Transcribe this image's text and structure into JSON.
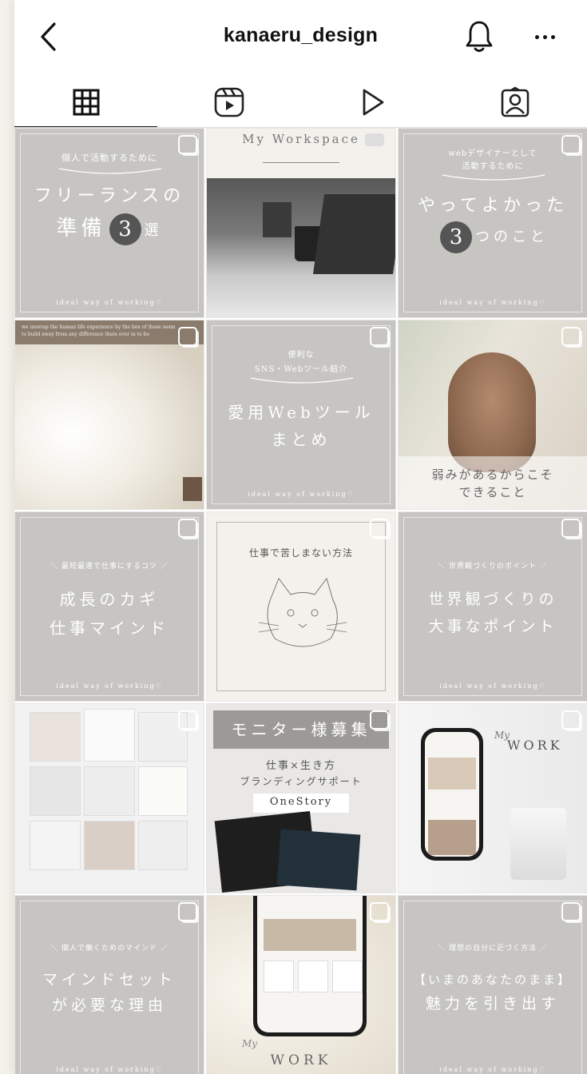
{
  "header": {
    "username": "kanaeru_design"
  },
  "tabs": [
    {
      "name": "grid"
    },
    {
      "name": "reels"
    },
    {
      "name": "videos"
    },
    {
      "name": "tagged"
    }
  ],
  "posts": {
    "p1": {
      "small": "個人で活動するために",
      "line1": "フリーランスの",
      "line2a": "準備",
      "num": "3",
      "line2b": "選",
      "foot": "ideal way of working♡"
    },
    "p2": {
      "title": "My Workspace"
    },
    "p3": {
      "small1": "webデザイナーとして",
      "small2": "活動するために",
      "line1": "やってよかった",
      "num": "3",
      "line2b": "つのこと",
      "foot": "ideal way of working♡"
    },
    "p4": {
      "text": "we unwrap the human life experience by the box of these seem to build away from any difference thats ever in to be"
    },
    "p5": {
      "small1": "便利な",
      "small2": "SNS・Webツール紹介",
      "line1": "愛用Webツール",
      "line2": "まとめ",
      "foot": "ideal way of working♡"
    },
    "p6": {
      "line1": "弱みがあるからこそ",
      "line2": "できること"
    },
    "p7": {
      "small": "＼ 最短最速で仕事にするコツ ／",
      "line1": "成長のカギ",
      "line2": "仕事マインド",
      "foot": "ideal way of working♡"
    },
    "p8": {
      "title": "仕事で苦しまない方法"
    },
    "p9": {
      "small": "＼ 世界観づくりのポイント ／",
      "line1": "世界観づくりの",
      "line2": "大事なポイント",
      "foot": "ideal way of working♡"
    },
    "p10": {},
    "p11": {
      "banner": "モニター様募集",
      "line1": "仕事×生き方",
      "line2": "ブランディングサポート",
      "brand": "OneStory"
    },
    "p12": {
      "script": "My",
      "word": "WORK"
    },
    "p13": {
      "small": "＼ 個人で働くためのマインド ／",
      "line1": "マインドセット",
      "line2": "が必要な理由",
      "foot": "ideal way of working♡"
    },
    "p14": {
      "script": "My",
      "word": "WORK"
    },
    "p15": {
      "small": "＼ 理想の自分に近づく方法 ／",
      "line1": "【いまのあなたのまま】",
      "line2": "魅力を引き出す",
      "foot": "ideal way of working♡"
    }
  }
}
